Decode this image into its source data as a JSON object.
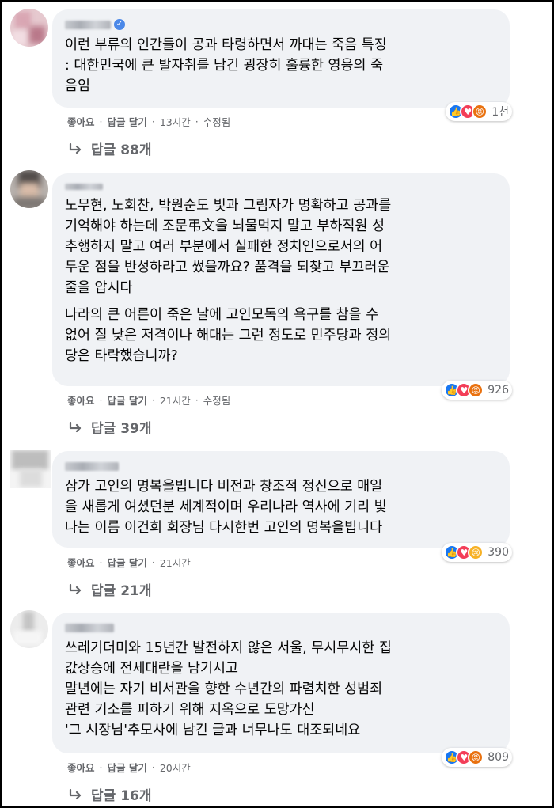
{
  "comments": [
    {
      "text": [
        "이런 부류의 인간들이 공과 타령하면서 까대는 죽음 특징\n: 대한민국에 큰 발자취를 남긴 굉장히 훌륭한 영웅의 죽\n음임"
      ],
      "actions": {
        "like": "좋아요",
        "reply": "답글 달기",
        "time": "13시간",
        "edited": "수정됨"
      },
      "reactions": {
        "types": [
          "like-icon",
          "love-icon",
          "angry-icon"
        ],
        "count": "1천"
      },
      "replies": "답글 88개"
    },
    {
      "text": [
        "노무현, 노회찬, 박원순도 빛과 그림자가 명확하고 공과를\n기억해야 하는데 조문弔文을 뇌물먹지 말고 부하직원 성\n추행하지 말고 여러 부분에서 실패한 정치인으로서의 어\n두운 점을 반성하라고 썼을까요? 품격을 되찾고 부끄러운\n줄을 압시다",
        "나라의 큰 어른이 죽은 날에 고인모독의 욕구를 참을 수\n없어 질 낮은 저격이나 해대는 그런 정도로 민주당과 정의\n당은 타락했습니까?"
      ],
      "actions": {
        "like": "좋아요",
        "reply": "답글 달기",
        "time": "21시간",
        "edited": "수정됨"
      },
      "reactions": {
        "types": [
          "like-icon",
          "love-icon",
          "angry-icon"
        ],
        "count": "926"
      },
      "replies": "답글 39개"
    },
    {
      "text": [
        "삼가 고인의 명복을빕니다 비전과 창조적 정신으로 매일\n을 새롭게 여셨던분 세계적이며 우리나라 역사에 기리 빛\n나는 이름 이건희 회장님 다시한번 고인의 명복을빕니다"
      ],
      "actions": {
        "like": "좋아요",
        "reply": "답글 달기",
        "time": "21시간",
        "edited": ""
      },
      "reactions": {
        "types": [
          "like-icon",
          "love-icon",
          "sad-icon"
        ],
        "count": "390"
      },
      "replies": "답글 21개"
    },
    {
      "text": [
        "쓰레기더미와 15년간 발전하지 않은 서울, 무시무시한 집\n값상승에 전세대란을 남기시고\n말년에는 자기 비서관을 향한 수년간의 파렴치한 성범죄\n관련 기소를 피하기 위해 지옥으로 도망가신\n'그 시장님'추모사에 남긴 글과 너무나도 대조되네요"
      ],
      "actions": {
        "like": "좋아요",
        "reply": "답글 달기",
        "time": "20시간",
        "edited": ""
      },
      "reactions": {
        "types": [
          "like-icon",
          "love-icon",
          "angry-icon"
        ],
        "count": "809"
      },
      "replies": "답글 16개"
    }
  ]
}
